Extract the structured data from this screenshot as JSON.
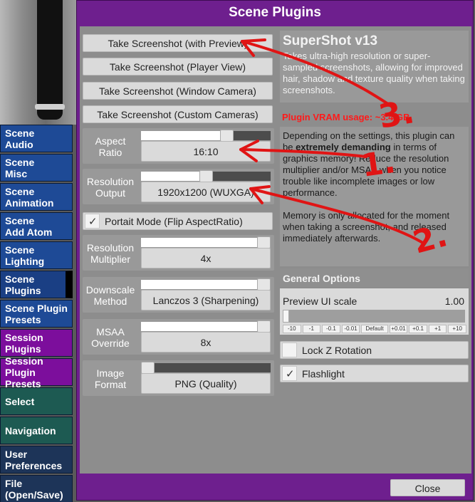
{
  "window": {
    "title": "Scene Plugins"
  },
  "left_menu": [
    {
      "label": "Scene\nAudio",
      "style": "blue"
    },
    {
      "label": "Scene\nMisc",
      "style": "blue"
    },
    {
      "label": "Scene\nAnimation",
      "style": "blue"
    },
    {
      "label": "Scene\nAdd Atom",
      "style": "blue"
    },
    {
      "label": "Scene\nLighting",
      "style": "blue"
    },
    {
      "label": "Scene\nPlugins",
      "style": "blue dark active"
    },
    {
      "label": "Scene Plugin\nPresets",
      "style": "blue"
    },
    {
      "label": "Session\nPlugins",
      "style": "purple"
    },
    {
      "label": "Session Plugin\nPresets",
      "style": "purple"
    },
    {
      "label": "Select",
      "style": "teal"
    },
    {
      "label": "Navigation",
      "style": "teal"
    },
    {
      "label": "User\nPreferences",
      "style": "navy"
    },
    {
      "label": "File\n(Open/Save)",
      "style": "navy"
    }
  ],
  "buttons": {
    "screenshot_preview": "Take Screenshot (with Preview)",
    "screenshot_player": "Take Screenshot (Player View)",
    "screenshot_window": "Take Screenshot (Window Camera)",
    "screenshot_custom": "Take Screenshot (Custom Cameras)",
    "close": "Close"
  },
  "settings": {
    "aspect_ratio": {
      "label": "Aspect\nRatio",
      "value": "16:10",
      "slider": 0.68
    },
    "resolution_output": {
      "label": "Resolution\nOutput",
      "value": "1920x1200 (WUXGA)",
      "slider": 0.5
    },
    "portrait_mode": {
      "label": "Portait Mode (Flip AspectRatio)",
      "checked": true
    },
    "resolution_multiplier": {
      "label": "Resolution\nMultiplier",
      "value": "4x",
      "slider": 1.0
    },
    "downscale_method": {
      "label": "Downscale\nMethod",
      "value": "Lanczos 3 (Sharpening)",
      "slider": 1.0
    },
    "msaa_override": {
      "label": "MSAA\nOverride",
      "value": "8x",
      "slider": 1.0
    },
    "image_format": {
      "label": "Image\nFormat",
      "value": "PNG (Quality)",
      "slider": 0.0
    }
  },
  "info": {
    "title": "SuperShot v13",
    "description": "Takes ultra-high resolution or super-sampled screenshots, allowing for improved hair, shadow and texture quality when taking screenshots.",
    "vram": "Plugin VRAM usage: ~3.4 GB.",
    "warning_part1": "Depending on the settings, this plugin can be ",
    "warning_bold": "extremely demanding",
    "warning_part2": " in terms of graphics memory! Reduce the resolution multiplier and/or MSAA when you notice trouble like incomplete images or low performance.",
    "warning_part3": "Memory is only allocated for the moment when taking a screenshot, and released immediately afterwards."
  },
  "general_options": {
    "header": "General Options",
    "preview_label": "Preview UI scale",
    "preview_value": "1.00",
    "preview_slider": 0.0,
    "steps": [
      "-10",
      "-1",
      "-0.1",
      "-0.01",
      "Default",
      "+0.01",
      "+0.1",
      "+1",
      "+10"
    ],
    "lock_z": {
      "label": "Lock Z Rotation",
      "checked": false
    },
    "flashlight": {
      "label": "Flashlight",
      "checked": true
    }
  },
  "annotations": {
    "colors": {
      "pen": "#e01414"
    },
    "labels": [
      "1.",
      "2.",
      "3."
    ]
  }
}
